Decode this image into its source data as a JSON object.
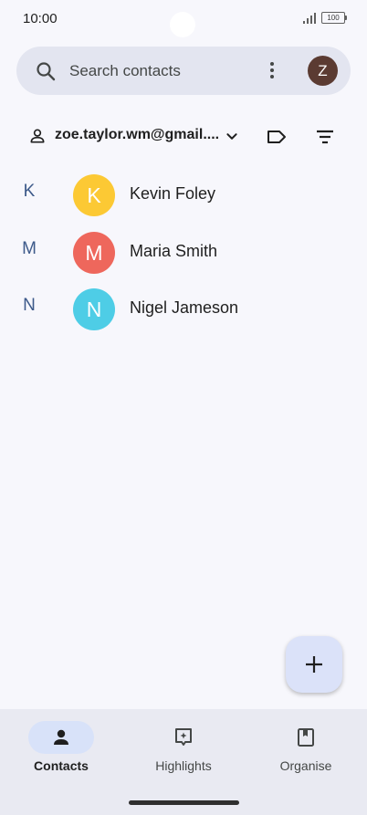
{
  "status": {
    "time": "10:00",
    "battery": "100"
  },
  "search": {
    "placeholder": "Search contacts",
    "account_initial": "Z"
  },
  "account": {
    "email": "zoe.taylor.wm@gmail...."
  },
  "contacts": [
    {
      "section": "K",
      "initial": "K",
      "name": "Kevin Foley",
      "color": "#fcc934"
    },
    {
      "section": "M",
      "initial": "M",
      "name": "Maria Smith",
      "color": "#ee675c"
    },
    {
      "section": "N",
      "initial": "N",
      "name": "Nigel Jameson",
      "color": "#4ecde6"
    }
  ],
  "nav": {
    "contacts": "Contacts",
    "highlights": "Highlights",
    "organise": "Organise"
  },
  "colors": {
    "accent": "#d8e2f9",
    "fab": "#dbe2f9",
    "account_avatar": "#5b3b32"
  }
}
